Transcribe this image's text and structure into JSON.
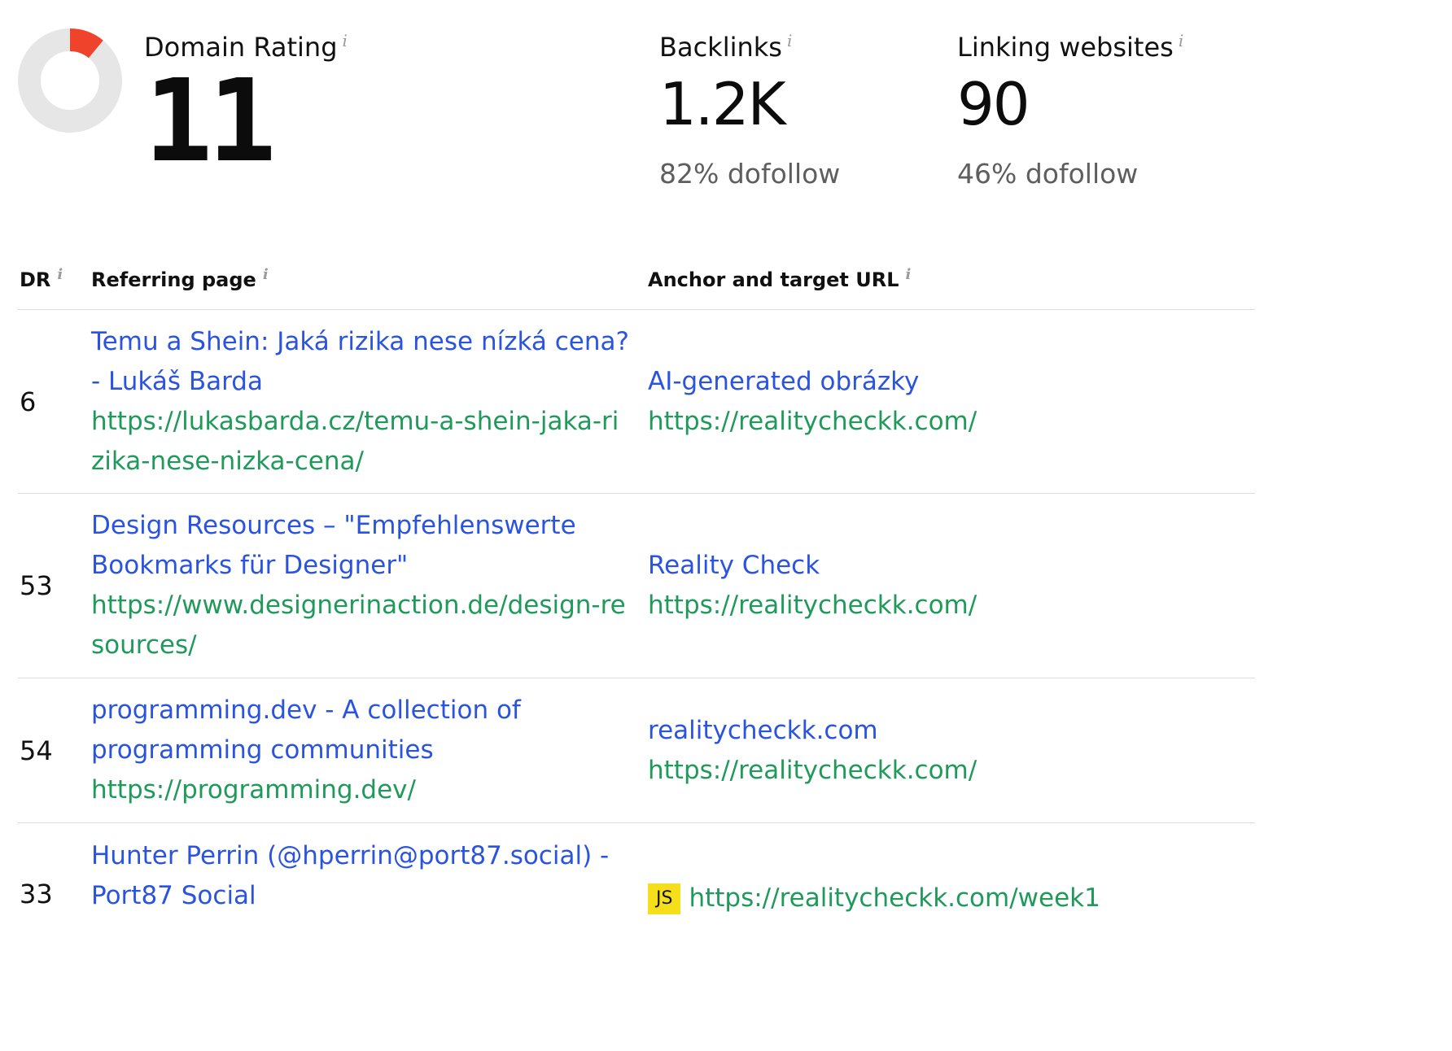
{
  "metrics": {
    "domain_rating": {
      "label": "Domain Rating",
      "value": "11",
      "gauge_fraction": 0.11,
      "gauge_color": "#f0432c",
      "track_color": "#e6e6e6"
    },
    "backlinks": {
      "label": "Backlinks",
      "value": "1.2K",
      "sub": "82% dofollow"
    },
    "linking_websites": {
      "label": "Linking websites",
      "value": "90",
      "sub": "46% dofollow"
    },
    "info_glyph": "i"
  },
  "table": {
    "headers": {
      "dr": "DR",
      "referring_page": "Referring page",
      "anchor_target": "Anchor and target URL"
    },
    "rows": [
      {
        "dr": "6",
        "ref_title": "Temu a Shein: Jaká rizika nese nízká cena? - Lukáš Barda",
        "ref_url": "https://lukasbarda.cz/temu-a-shein-jaka-rizika-nese-nizka-cena/",
        "anchor": "AI-generated obrázky",
        "target_url": "https://realitycheckk.com/"
      },
      {
        "dr": "53",
        "ref_title": "Design Resources – \"Empfehlenswerte Bookmarks für Designer\"",
        "ref_url": "https://www.designerinaction.de/design-resources/",
        "anchor": "Reality Check",
        "target_url": "https://realitycheckk.com/"
      },
      {
        "dr": "54",
        "ref_title": "programming.dev - A collection of programming communities",
        "ref_url": "https://programming.dev/",
        "anchor": "realitycheckk.com",
        "target_url": "https://realitycheckk.com/"
      },
      {
        "dr": "33",
        "ref_title": "Hunter Perrin (@hperrin@port87.social) - Port87 Social",
        "badge": "JS",
        "badge_color": "#f5df1b",
        "target_url": "https://realitycheckk.com/week1"
      }
    ]
  },
  "colors": {
    "link_blue": "#2a54e0",
    "url_green": "#1f9a5a",
    "divider": "#dcdcdc"
  }
}
